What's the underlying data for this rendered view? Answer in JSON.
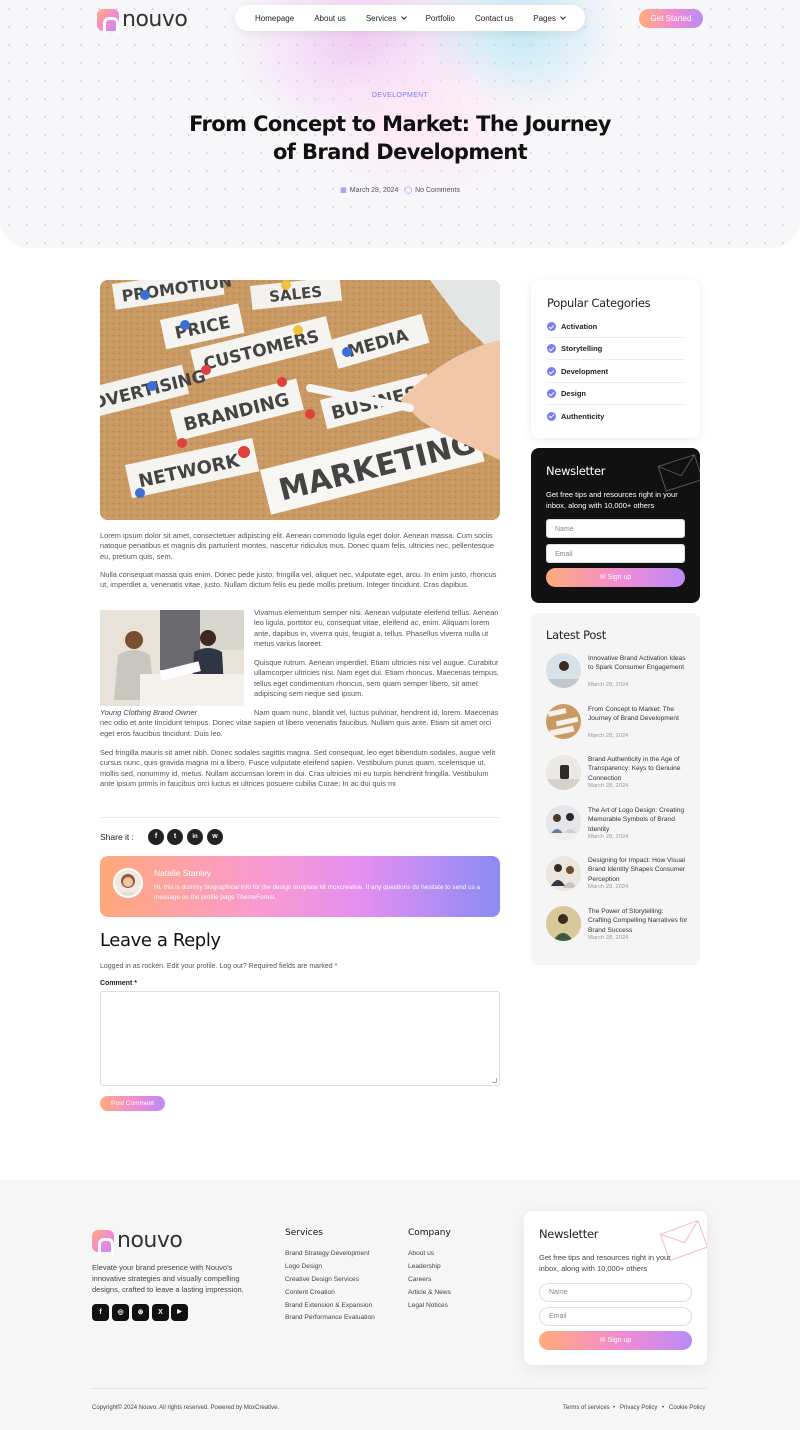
{
  "brand": {
    "name": "nouvo"
  },
  "header": {
    "nav": [
      {
        "label": "Homepage"
      },
      {
        "label": "About us"
      },
      {
        "label": "Services",
        "dropdown": true
      },
      {
        "label": "Portfolio"
      },
      {
        "label": "Contact us"
      },
      {
        "label": "Pages",
        "dropdown": true
      }
    ],
    "cta_label": "Get Started"
  },
  "article": {
    "category": "DEVELOPMENT",
    "title": "From Concept to Market: The Journey of Brand Development",
    "date": "March 28, 2024",
    "comments": "No Comments",
    "featured_words": [
      "PROMOTION",
      "SALES",
      "PRICE",
      "CUSTOMERS",
      "MEDIA",
      "ADVERTISING",
      "BRANDING",
      "BUSINESS",
      "NETWORK",
      "MARKETING"
    ],
    "paragraphs": [
      "Lorem ipsum dolor sit amet, consectetuer adipiscing elit. Aenean commodo ligula eget dolor. Aenean massa. Cum sociis natoque penatibus et magnis dis parturient montes, nascetur ridiculus mus. Donec quam felis, ultricies nec, pellentesque eu, pretium quis, sem.",
      "Nulla consequat massa quis enim. Donec pede justo, fringilla vel, aliquet nec, vulputate eget, arcu. In enim justo, rhoncus ut, imperdiet a, venenatis vitae, justo. Nullam dictum felis eu pede mollis pretium. Integer tincidunt. Cras dapibus.",
      "Vivamus elementum semper nisi. Aenean vulputate eleifend tellus. Aenean leo ligula, porttitor eu, consequat vitae, eleifend ac, enim. Aliquam lorem ante, dapibus in, viverra quis, feugiat a, tellus. Phasellus viverra nulla ut metus varius laoreet.",
      "Quisque rutrum. Aenean imperdiet. Etiam ultricies nisi vel augue. Curabitur ullamcorper ultricies nisi. Nam eget dui. Etiam rhoncus. Maecenas tempus, tellus eget condimentum rhoncus, sem quam semper libero, sit amet adipiscing sem neque sed ipsum.",
      "Nam quam nunc, blandit vel, luctus pulvinar, hendrerit id, lorem. Maecenas nec odio et ante tincidunt tempus. Donec vitae sapien ut libero venenatis faucibus. Nullam quis ante. Etiam sit amet orci eget eros faucibus tincidunt. Duis leo.",
      "Sed fringilla mauris sit amet nibh. Donec sodales sagittis magna. Sed consequat, leo eget bibendum sodales, augue velit cursus nunc, quis gravida magna mi a libero. Fusce vulputate eleifend sapien. Vestibulum purus quam, scelerisque ut, mollis sed, nonummy id, metus. Nullam accumsan lorem in dui. Cras ultricies mi eu turpis hendrerit fringilla. Vestibulum ante ipsum primis in faucibus orci luctus et ultrices posuere cubilia Curae; In ac dui quis mi"
    ],
    "image_caption": "Young Clothing Brand Owner",
    "share_label": "Share it :",
    "share_icons": [
      {
        "icon": "facebook-icon",
        "glyph": "f"
      },
      {
        "icon": "twitter-icon",
        "glyph": "t"
      },
      {
        "icon": "linkedin-icon",
        "glyph": "in"
      },
      {
        "icon": "whatsapp-icon",
        "glyph": "w"
      }
    ]
  },
  "author": {
    "name": "Natalie Stanley",
    "bio": "Hi, this is dummy biographical info for the design template kit moxcreative. If any questions do hesitate to send us a message on the profile page ThemeForest."
  },
  "reply": {
    "title": "Leave a Reply",
    "logged_in": "Logged in as rocken. Edit your profile. Log out? Required fields are marked *",
    "comment_label": "Comment *",
    "submit_label": "Post Comment"
  },
  "sidebar": {
    "categories_title": "Popular Categories",
    "categories": [
      "Activation",
      "Storytelling",
      "Development",
      "Design",
      "Authenticity"
    ],
    "newsletter": {
      "title": "Newsletter",
      "text": "Get free tips and resources right in your inbox, along with 10,000+ others",
      "name_placeholder": "Name",
      "email_placeholder": "Email",
      "button_label": "Sign up"
    },
    "latest_title": "Latest Post",
    "posts": [
      {
        "title": "Innovative Brand Activation Ideas to Spark Consumer Engagement",
        "date": "March 28, 2024"
      },
      {
        "title": "From Concept to Market: The Journey of Brand Development",
        "date": "March 28, 2024"
      },
      {
        "title": "Brand Authenticity in the Age of Transparency: Keys to Genuine Connection",
        "date": "March 28, 2024"
      },
      {
        "title": "The Art of Logo Design: Creating Memorable Symbols of Brand Identity",
        "date": "March 28, 2024"
      },
      {
        "title": "Designing for Impact: How Visual Brand Identity Shapes Consumer Perception",
        "date": "March 28, 2024"
      },
      {
        "title": "The Power of Storytelling: Crafting Compelling Narratives for Brand Success",
        "date": "March 28, 2024"
      }
    ]
  },
  "footer": {
    "description": "Elevate your brand presence with Nouvo's innovative strategies and visually compelling designs, crafted to leave a lasting impression.",
    "social": [
      {
        "icon": "facebook-icon",
        "glyph": "f"
      },
      {
        "icon": "instagram-icon",
        "glyph": "◎"
      },
      {
        "icon": "dribbble-icon",
        "glyph": "⊛"
      },
      {
        "icon": "x-icon",
        "glyph": "X"
      },
      {
        "icon": "youtube-icon",
        "glyph": "▶"
      }
    ],
    "services_title": "Services",
    "services": [
      "Brand Strategy Development",
      "Logo Design",
      "Creative Design Services",
      "Content Creation",
      "Brand Extension & Expansion",
      "Brand Performance Evaluation"
    ],
    "company_title": "Company",
    "company": [
      "About us",
      "Leadership",
      "Careers",
      "Article & News",
      "Legal Notices"
    ],
    "newsletter": {
      "title": "Newsletter",
      "text": "Get free tips and resources right in your inbox, along with 10,000+ others",
      "name_placeholder": "Name",
      "email_placeholder": "Email",
      "button_label": "Sign up"
    },
    "copyright": "Copyright© 2024 Nouvo. All rights reserved. Powered by MoxCreative.",
    "legal": [
      "Terms of services",
      "Privacy Policy",
      "Cookie Policy"
    ]
  },
  "colors": {
    "accent": "#7b7cf2",
    "gradient_start": "#ffab7a",
    "gradient_mid": "#f18bd3",
    "gradient_end": "#b98bf7",
    "dark": "#111111"
  }
}
